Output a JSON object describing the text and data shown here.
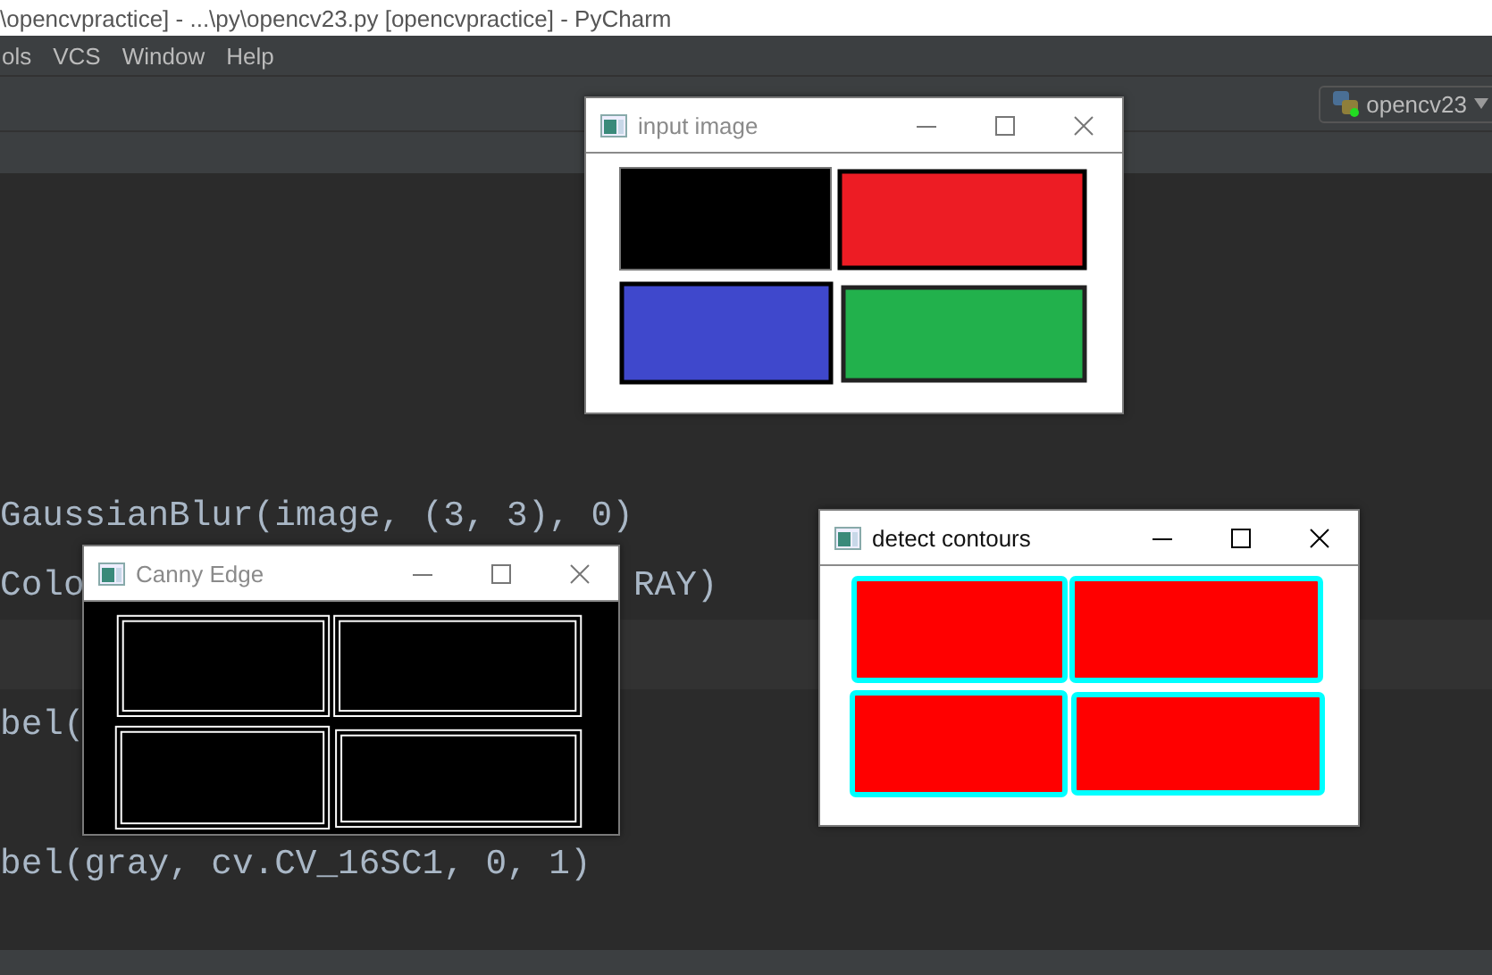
{
  "ide_title": "\\opencvpractice] - ...\\py\\opencv23.py [opencvpractice] - PyCharm",
  "menu": [
    {
      "label": "ols"
    },
    {
      "label": "VCS"
    },
    {
      "label": "Window"
    },
    {
      "label": "Help"
    }
  ],
  "run_config": {
    "label": "opencv23"
  },
  "editor": {
    "lines": [
      {
        "kind": "code",
        "parts": [
          "GaussianBlur(image, (3, 3), 0)"
        ]
      },
      {
        "kind": "code",
        "parts": [
          "Colo",
          "RAY)"
        ]
      },
      {
        "kind": "caret-line"
      },
      {
        "kind": "code",
        "parts": [
          "bel("
        ]
      },
      {
        "kind": "blank"
      },
      {
        "kind": "code",
        "parts": [
          "bel(gray, cv.CV_16SC1, 0, 1)"
        ]
      }
    ]
  },
  "windows": [
    {
      "title": "input image",
      "active": false
    },
    {
      "title": "Canny Edge",
      "active": false
    },
    {
      "title": "detect contours",
      "active": true
    }
  ]
}
